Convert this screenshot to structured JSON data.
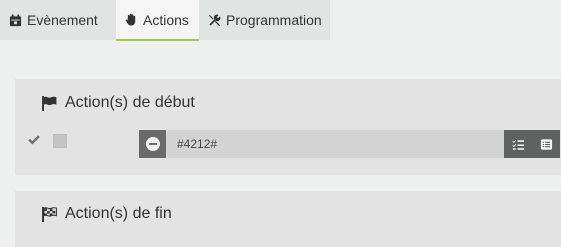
{
  "tabs": [
    {
      "label": "Evènement",
      "icon": "calendar-icon"
    },
    {
      "label": "Actions",
      "icon": "hand-icon"
    },
    {
      "label": "Programmation",
      "icon": "wrench-icon"
    }
  ],
  "active_tab": "Actions",
  "accent_color": "#9ccc4b",
  "start_panel": {
    "title": "Action(s) de début",
    "icon": "flag-icon",
    "action": {
      "enabled_icon": "check-icon",
      "command_value": "#4212#",
      "buttons": [
        "list-check-icon",
        "list-icon"
      ]
    }
  },
  "end_panel": {
    "title": "Action(s) de fin",
    "icon": "checkered-flag-icon"
  }
}
